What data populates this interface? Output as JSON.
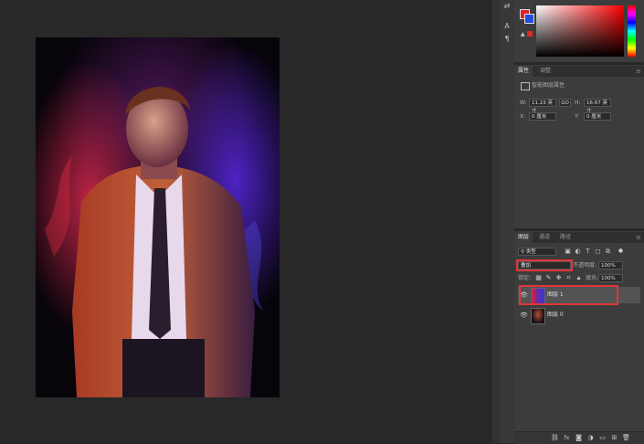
{
  "tools": {
    "swap_icon": "⇄",
    "type_icon": "A",
    "para_icon": "¶"
  },
  "properties": {
    "tabs": [
      "属性",
      "调整"
    ],
    "section_title": "智能图层属性",
    "w_label": "W:",
    "w_value": "11.23 英寸",
    "link_label": "GO",
    "h_label": "H:",
    "h_value": "16.67 英寸",
    "x_label": "X:",
    "x_value": "0 厘米",
    "y_label": "Y:",
    "y_value": "0 厘米"
  },
  "layers_panel": {
    "tabs": [
      "图层",
      "通道",
      "路径"
    ],
    "filter_kind": "类型",
    "blend_mode": "叠加",
    "opacity_label": "不透明度:",
    "opacity_value": "100%",
    "lock_label": "锁定:",
    "fill_label": "填充:",
    "fill_value": "100%",
    "layers": [
      {
        "name": "图层 1",
        "selected": true
      },
      {
        "name": "图层 0",
        "selected": false
      }
    ],
    "footer_icons": [
      "link",
      "fx",
      "mask",
      "adjust",
      "group",
      "new",
      "trash"
    ]
  },
  "colors": {
    "highlight": "#e0353a",
    "foreground": "#e0202a",
    "background": "#2050e0"
  }
}
